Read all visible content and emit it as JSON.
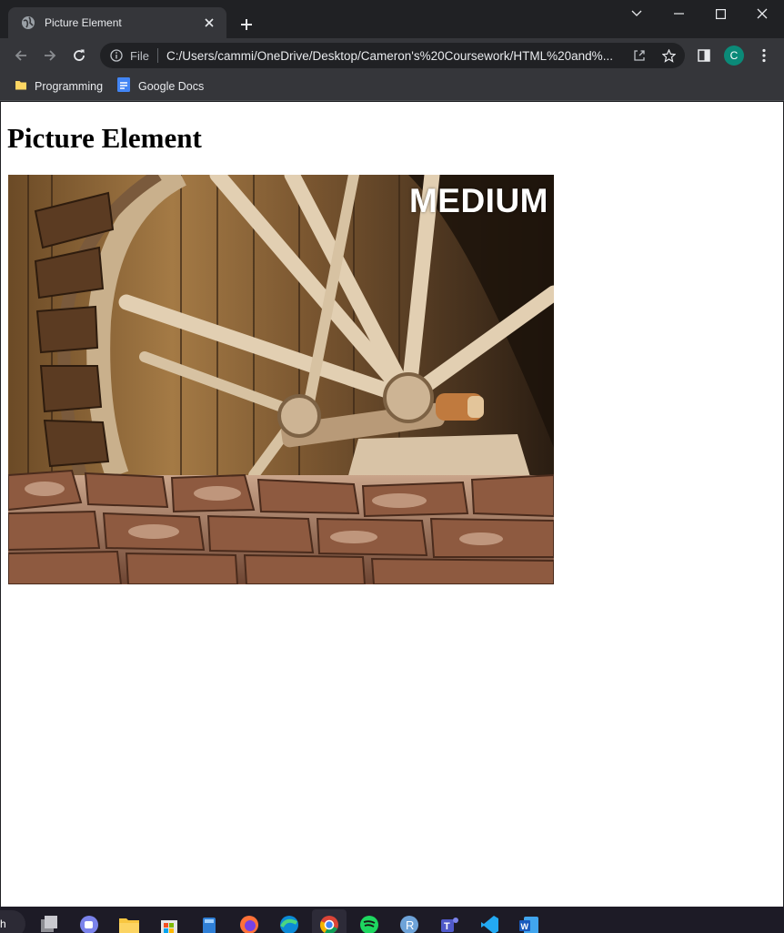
{
  "browser": {
    "tab": {
      "title": "Picture Element"
    },
    "address_bar": {
      "scheme_label": "File",
      "url": "C:/Users/cammi/OneDrive/Desktop/Cameron's%20Coursework/HTML%20and%..."
    },
    "profile_initial": "C",
    "bookmarks": [
      {
        "label": "Programming",
        "icon": "folder-icon"
      },
      {
        "label": "Google Docs",
        "icon": "google-docs-icon"
      }
    ]
  },
  "page": {
    "heading": "Picture Element",
    "picture": {
      "subject": "water-wheel",
      "size_label": "MEDIUM"
    }
  },
  "taskbar": {
    "search_text": "h",
    "apps": [
      "task-view-icon",
      "teams-chat-icon",
      "file-explorer-icon",
      "microsoft-store-icon",
      "calculator-icon",
      "firefox-icon",
      "edge-icon",
      "chrome-icon",
      "spotify-icon",
      "r-icon",
      "teams-icon",
      "vscode-icon",
      "word-icon"
    ],
    "active_app": "chrome-icon"
  },
  "colors": {
    "titlebar": "#202124",
    "toolbar": "#35363a",
    "page_background": "#ffffff",
    "avatar": "#0b8a78",
    "taskbar": "#1d1b26"
  }
}
